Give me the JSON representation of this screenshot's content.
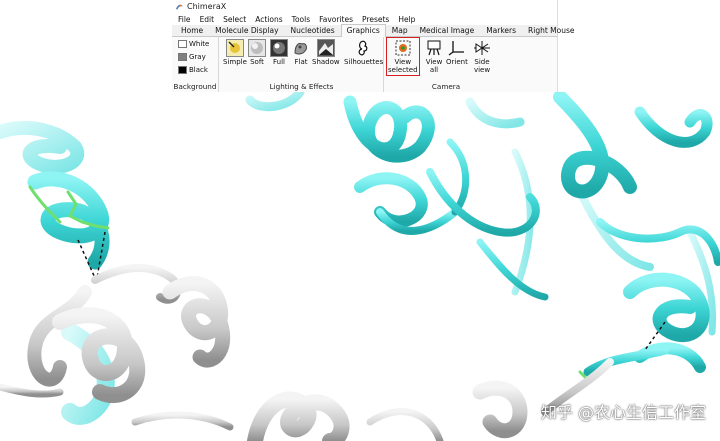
{
  "window": {
    "title": "ChimeraX"
  },
  "menu": [
    "File",
    "Edit",
    "Select",
    "Actions",
    "Tools",
    "Favorites",
    "Presets",
    "Help"
  ],
  "tabs": [
    "Home",
    "Molecule Display",
    "Nucleotides",
    "Graphics",
    "Map",
    "Medical Image",
    "Markers",
    "Right Mouse"
  ],
  "active_tab": "Graphics",
  "ribbon": {
    "background": {
      "label": "Background",
      "options": [
        {
          "label": "White",
          "color": "#ffffff"
        },
        {
          "label": "Gray",
          "color": "#808080"
        },
        {
          "label": "Black",
          "color": "#000000"
        }
      ]
    },
    "lighting": {
      "label": "Lighting & Effects",
      "tools": [
        "Simple",
        "Soft",
        "Full",
        "Flat",
        "Shadow",
        "Silhouettes"
      ]
    },
    "camera": {
      "label": "Camera",
      "tools": [
        {
          "line1": "View",
          "line2": "selected",
          "selected": true
        },
        {
          "line1": "View",
          "line2": "all"
        },
        {
          "line1": "Orient",
          "line2": ""
        },
        {
          "line1": "Side",
          "line2": "view"
        }
      ]
    }
  },
  "colors": {
    "helix_cyan": "#3fd6d6",
    "helix_gray": "#c8c8c8",
    "highlight_red": "#d62020",
    "selection_green": "#6fe06f"
  },
  "watermark": "知乎 @农心生信工作室"
}
